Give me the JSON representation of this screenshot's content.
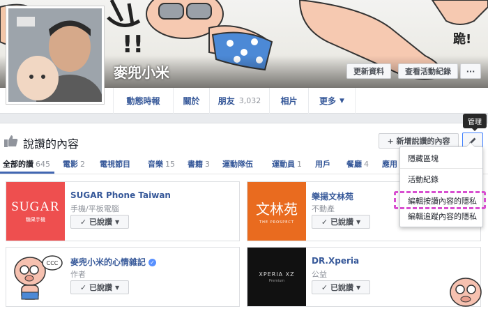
{
  "profile": {
    "name": "麥兜小米",
    "update_info": "更新資料",
    "activity_log": "查看活動紀錄",
    "more": "···"
  },
  "nav": [
    {
      "label": "動態時報"
    },
    {
      "label": "關於"
    },
    {
      "label": "朋友",
      "count": "3,032"
    },
    {
      "label": "相片"
    },
    {
      "label": "更多"
    }
  ],
  "likes": {
    "title": "說讚的內容",
    "add_button": "+ 新增說讚的內容",
    "tooltip": "管理",
    "filters": [
      {
        "label": "全部的讚",
        "count": "645"
      },
      {
        "label": "電影",
        "count": "2"
      },
      {
        "label": "電視節目",
        "count": ""
      },
      {
        "label": "音樂",
        "count": "15"
      },
      {
        "label": "書籍",
        "count": "3"
      },
      {
        "label": "運動隊伍",
        "count": ""
      },
      {
        "label": "運動員",
        "count": "1"
      },
      {
        "label": "用戶",
        "count": ""
      },
      {
        "label": "餐廳",
        "count": "4"
      },
      {
        "label": "應用",
        "count": ""
      }
    ],
    "pages": [
      {
        "name": "SUGAR Phone Taiwan",
        "category": "手機/平板電腦",
        "logo_text": "SUGAR",
        "logo_sub": "糖果手機",
        "logo_bg": "#ee4f4f",
        "button": "已說讚"
      },
      {
        "name": "樂揚文林苑",
        "category": "不動產",
        "logo_text": "文林苑",
        "logo_sub": "THE PROSPECT",
        "logo_bg": "#e96b1f",
        "button": "已說讚"
      },
      {
        "name": "麥兜小米的心情雜記",
        "category": "作者",
        "verified": true,
        "logo_text": "CCC",
        "logo_bg": "#ffffff",
        "button": "已說讚"
      },
      {
        "name": "DR.Xperia",
        "category": "公益",
        "logo_text": "XPERIA XZ",
        "logo_sub": "Premium",
        "logo_bg": "#111111",
        "button": "已說讚"
      }
    ]
  },
  "menu": {
    "items": [
      "隱藏區塊",
      "活動紀錄",
      "編輯按讚內容的隱私",
      "編輯追蹤內容的隱私"
    ],
    "highlight_color": "#d84fd0"
  },
  "colors": {
    "link": "#365899",
    "accent": "#4267b2",
    "background": "#e9ebee"
  }
}
